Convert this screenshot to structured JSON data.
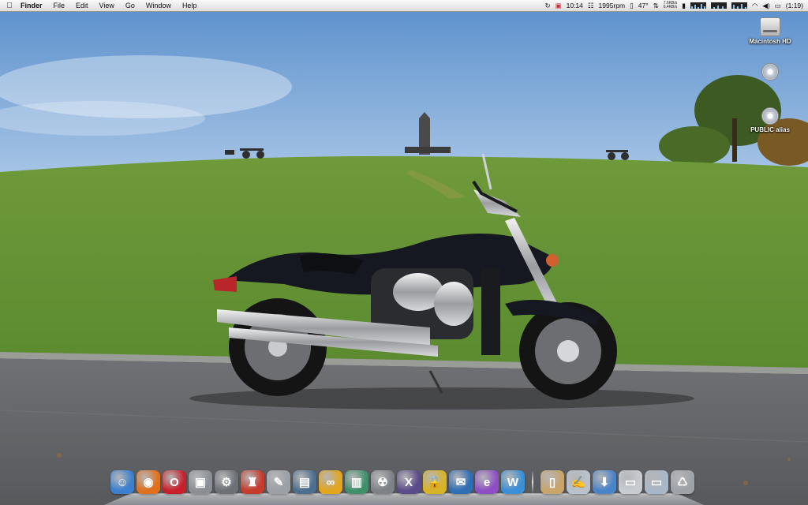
{
  "menubar": {
    "apple_icon": "apple-logo-icon",
    "app_name": "Finder",
    "menus": [
      "File",
      "Edit",
      "View",
      "Go",
      "Window",
      "Help"
    ],
    "status": {
      "clock": "10:14",
      "fan_speed": "1995rpm",
      "temperature": "47°",
      "net_up": "7.6KB/s",
      "net_down": "6.4KB/s",
      "battery": "(1:19)"
    }
  },
  "desktop_icons": [
    {
      "label": "Macintosh HD",
      "icon": "hard-drive-icon"
    },
    {
      "label": "",
      "icon": "network-volume-icon"
    },
    {
      "label": "PUBLIC alias",
      "icon": "alias-disc-icon"
    }
  ],
  "dock": {
    "apps": [
      {
        "name": "finder-icon",
        "glyph": "☺",
        "color": "#3a7fd0"
      },
      {
        "name": "firefox-icon",
        "glyph": "◉",
        "color": "#e0701c"
      },
      {
        "name": "opera-icon",
        "glyph": "O",
        "color": "#c8202a"
      },
      {
        "name": "preview-icon",
        "glyph": "▣",
        "color": "#8a8f96"
      },
      {
        "name": "system-preferences-icon",
        "glyph": "⚙",
        "color": "#6c7178"
      },
      {
        "name": "chair-app-icon",
        "glyph": "♜",
        "color": "#c63b2b"
      },
      {
        "name": "scanner-icon",
        "glyph": "✎",
        "color": "#9aa0a6"
      },
      {
        "name": "iphoto-icon",
        "glyph": "▤",
        "color": "#4e6e8f"
      },
      {
        "name": "brain-app-icon",
        "glyph": "∞",
        "color": "#e3a51c"
      },
      {
        "name": "image-viewer-icon",
        "glyph": "▥",
        "color": "#3f8f6a"
      },
      {
        "name": "radiation-app-icon",
        "glyph": "☢",
        "color": "#7d8288"
      },
      {
        "name": "mac-os-x-icon",
        "glyph": "X",
        "color": "#5b4b8a"
      },
      {
        "name": "keychain-icon",
        "glyph": "🔒",
        "color": "#d8b326"
      },
      {
        "name": "thunderbird-icon",
        "glyph": "✉",
        "color": "#2f6db5"
      },
      {
        "name": "mail-client-icon",
        "glyph": "e",
        "color": "#8e4fc4"
      },
      {
        "name": "browser-w-icon",
        "glyph": "W",
        "color": "#3a8fd6"
      }
    ],
    "stacks": [
      {
        "name": "documents-stack-icon",
        "glyph": "▯",
        "color": "#c8a46a"
      },
      {
        "name": "textedit-icon",
        "glyph": "✍",
        "color": "#b9c2cc"
      },
      {
        "name": "downloads-stack-icon",
        "glyph": "⬇",
        "color": "#4a84c8"
      },
      {
        "name": "window-preview-icon",
        "glyph": "▭",
        "color": "#c8ccd2"
      },
      {
        "name": "window-preview-2-icon",
        "glyph": "▭",
        "color": "#a8b7c8"
      },
      {
        "name": "trash-icon",
        "glyph": "♺",
        "color": "#9ea3a9"
      }
    ]
  }
}
